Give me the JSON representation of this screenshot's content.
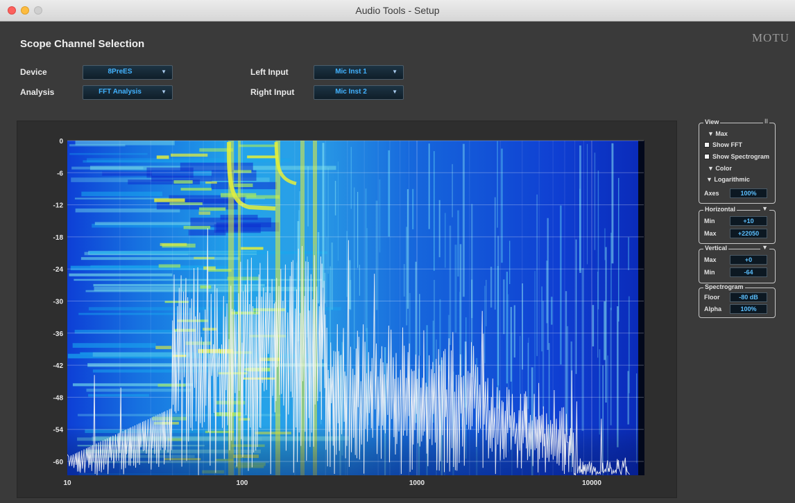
{
  "window": {
    "title": "Audio Tools - Setup"
  },
  "brand": "MOTU",
  "scope": {
    "title": "Scope Channel Selection",
    "device_label": "Device",
    "device_value": "8PreES",
    "analysis_label": "Analysis",
    "analysis_value": "FFT Analysis",
    "left_input_label": "Left Input",
    "left_input_value": "Mic Inst 1",
    "right_input_label": "Right Input",
    "right_input_value": "Mic Inst 2"
  },
  "plot": {
    "y_ticks": [
      "0",
      "-6",
      "-12",
      "-18",
      "-24",
      "-30",
      "-36",
      "-42",
      "-48",
      "-54",
      "-60"
    ],
    "x_ticks": [
      "10",
      "100",
      "1000",
      "10000"
    ],
    "scale": "logarithmic frequency",
    "colors": {
      "low": "#0c2fd0",
      "mid": "#19a8ee",
      "high": "#e4ef3a",
      "trace": "#f6f6f6"
    }
  },
  "panel": {
    "view": {
      "legend": "View",
      "collapse_icon": "II",
      "max_label": "Max",
      "show_fft_label": "Show FFT",
      "show_fft_checked": false,
      "show_spectrogram_label": "Show Spectrogram",
      "show_spectrogram_checked": false,
      "color_label": "Color",
      "logarithmic_label": "Logarithmic",
      "axes_label": "Axes",
      "axes_value": "100%"
    },
    "horizontal": {
      "legend": "Horizontal",
      "min_label": "Min",
      "min_value": "+10",
      "max_label": "Max",
      "max_value": "+22050"
    },
    "vertical": {
      "legend": "Vertical",
      "max_label": "Max",
      "max_value": "+0",
      "min_label": "Min",
      "min_value": "-64"
    },
    "spectrogram": {
      "legend": "Spectrogram",
      "floor_label": "Floor",
      "floor_value": "-80 dB",
      "alpha_label": "Alpha",
      "alpha_value": "100%"
    }
  }
}
